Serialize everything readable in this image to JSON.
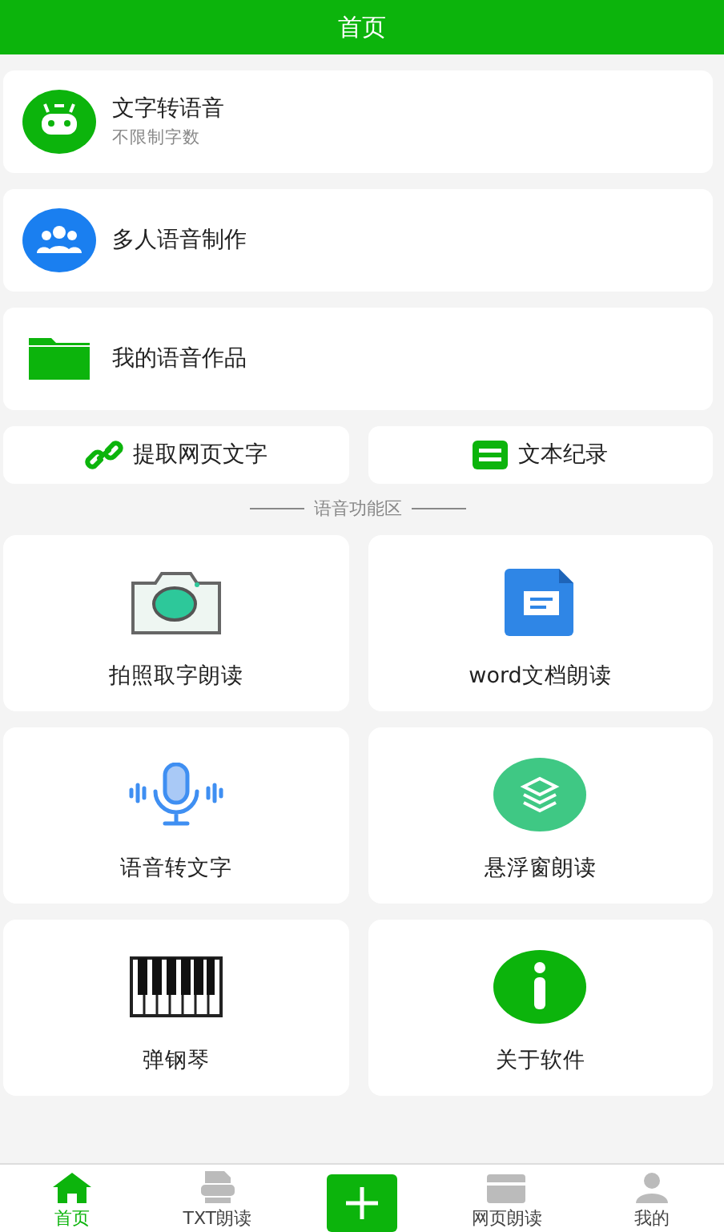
{
  "header": {
    "title": "首页"
  },
  "list_items": [
    {
      "title": "文字转语音",
      "subtitle": "不限制字数"
    },
    {
      "title": "多人语音制作"
    },
    {
      "title": "我的语音作品"
    }
  ],
  "quick_buttons": [
    {
      "label": "提取网页文字"
    },
    {
      "label": "文本纪录"
    }
  ],
  "section_title": "语音功能区",
  "features": [
    {
      "label": "拍照取字朗读"
    },
    {
      "label": "word文档朗读"
    },
    {
      "label": "语音转文字"
    },
    {
      "label": "悬浮窗朗读"
    },
    {
      "label": "弹钢琴"
    },
    {
      "label": "关于软件"
    }
  ],
  "tab_bar": [
    {
      "kind": "tab",
      "label": "首页",
      "selected": true
    },
    {
      "kind": "tab",
      "label": "TXT朗读",
      "selected": false
    },
    {
      "kind": "add"
    },
    {
      "kind": "tab",
      "label": "网页朗读",
      "selected": false
    },
    {
      "kind": "tab",
      "label": "我的",
      "selected": false
    }
  ]
}
